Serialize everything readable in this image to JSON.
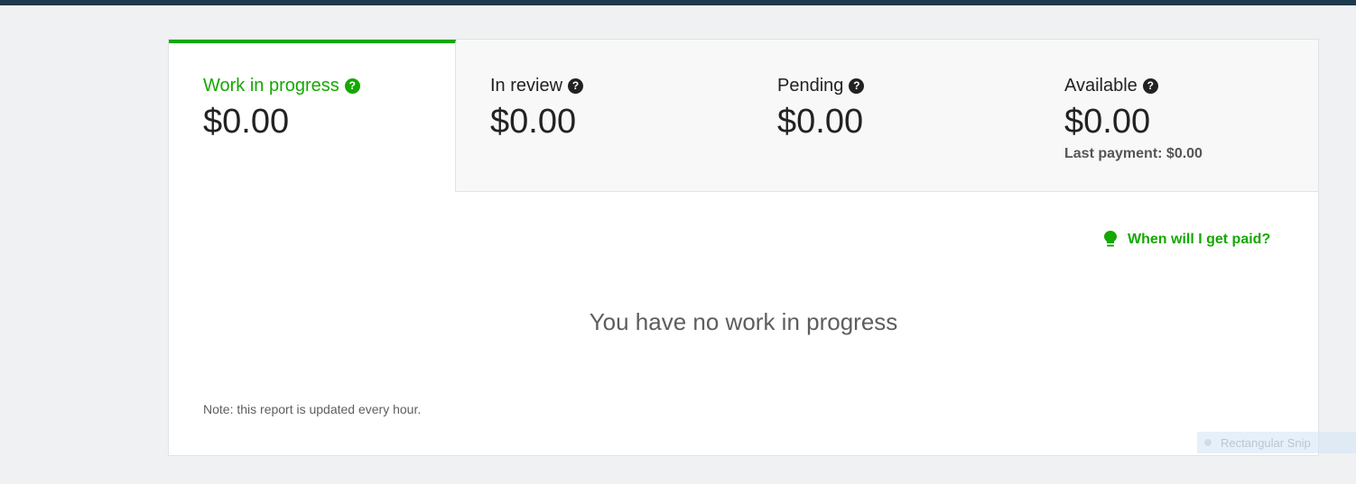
{
  "tabs": [
    {
      "label": "Work in progress",
      "amount": "$0.00",
      "sub": ""
    },
    {
      "label": "In review",
      "amount": "$0.00",
      "sub": ""
    },
    {
      "label": "Pending",
      "amount": "$0.00",
      "sub": ""
    },
    {
      "label": "Available",
      "amount": "$0.00",
      "sub": "Last payment: $0.00"
    }
  ],
  "help_icon_glyph": "?",
  "paid_link": "When will I get paid?",
  "empty_message": "You have no work in progress",
  "note": "Note: this report is updated every hour.",
  "snip_label": "Rectangular Snip",
  "colors": {
    "accent": "#14a800",
    "topbar": "#1f3a4d",
    "text": "#222222",
    "muted": "#5e5e5e"
  }
}
